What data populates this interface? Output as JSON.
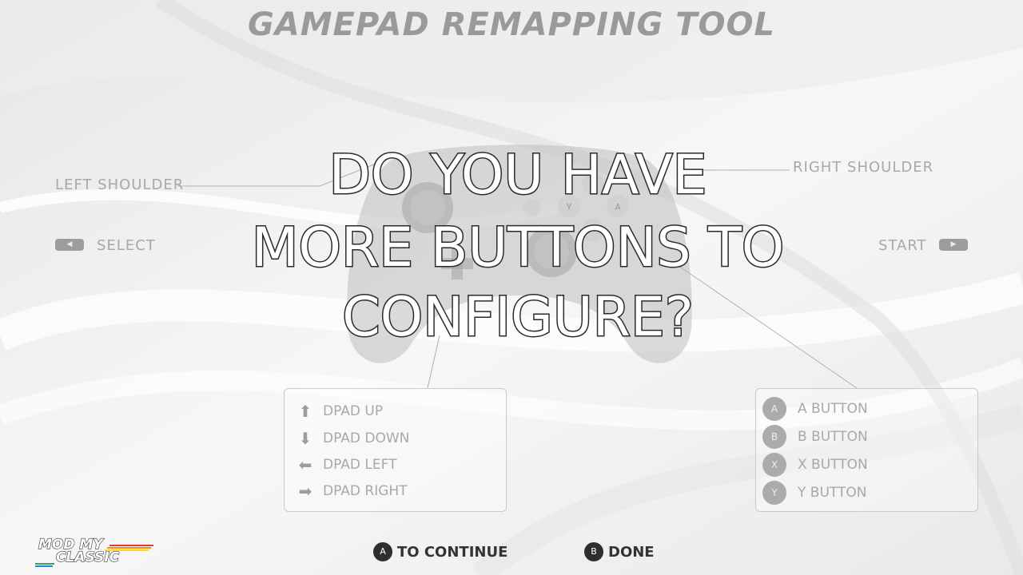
{
  "header": {
    "title": "GAMEPAD REMAPPING TOOL"
  },
  "labels": {
    "left_shoulder": "LEFT SHOULDER",
    "right_shoulder": "RIGHT SHOULDER",
    "select": "SELECT",
    "start": "START"
  },
  "controller": {
    "face_buttons": [
      "Y",
      "A"
    ]
  },
  "prompt": {
    "lines": [
      "DO YOU HAVE",
      "MORE BUTTONS TO",
      "CONFIGURE?"
    ]
  },
  "dpad_box": {
    "items": [
      {
        "icon": "arrow-up-icon",
        "label": "DPAD UP"
      },
      {
        "icon": "arrow-down-icon",
        "label": "DPAD DOWN"
      },
      {
        "icon": "arrow-left-icon",
        "label": "DPAD LEFT"
      },
      {
        "icon": "arrow-right-icon",
        "label": "DPAD RIGHT"
      }
    ]
  },
  "buttons_box": {
    "items": [
      {
        "badge": "A",
        "label": "A BUTTON"
      },
      {
        "badge": "B",
        "label": "B BUTTON"
      },
      {
        "badge": "X",
        "label": "X BUTTON"
      },
      {
        "badge": "Y",
        "label": "Y BUTTON"
      }
    ]
  },
  "footer": {
    "continue": {
      "badge": "A",
      "label": "TO CONTINUE"
    },
    "done": {
      "badge": "B",
      "label": "DONE"
    }
  },
  "logo": {
    "line1": "MOD MY",
    "line2": "CLASSIC"
  },
  "colors": {
    "background": "#f2f2f2",
    "title": "#9a9a9a",
    "footer_text": "#333333",
    "outline_text": "#ffffff"
  }
}
